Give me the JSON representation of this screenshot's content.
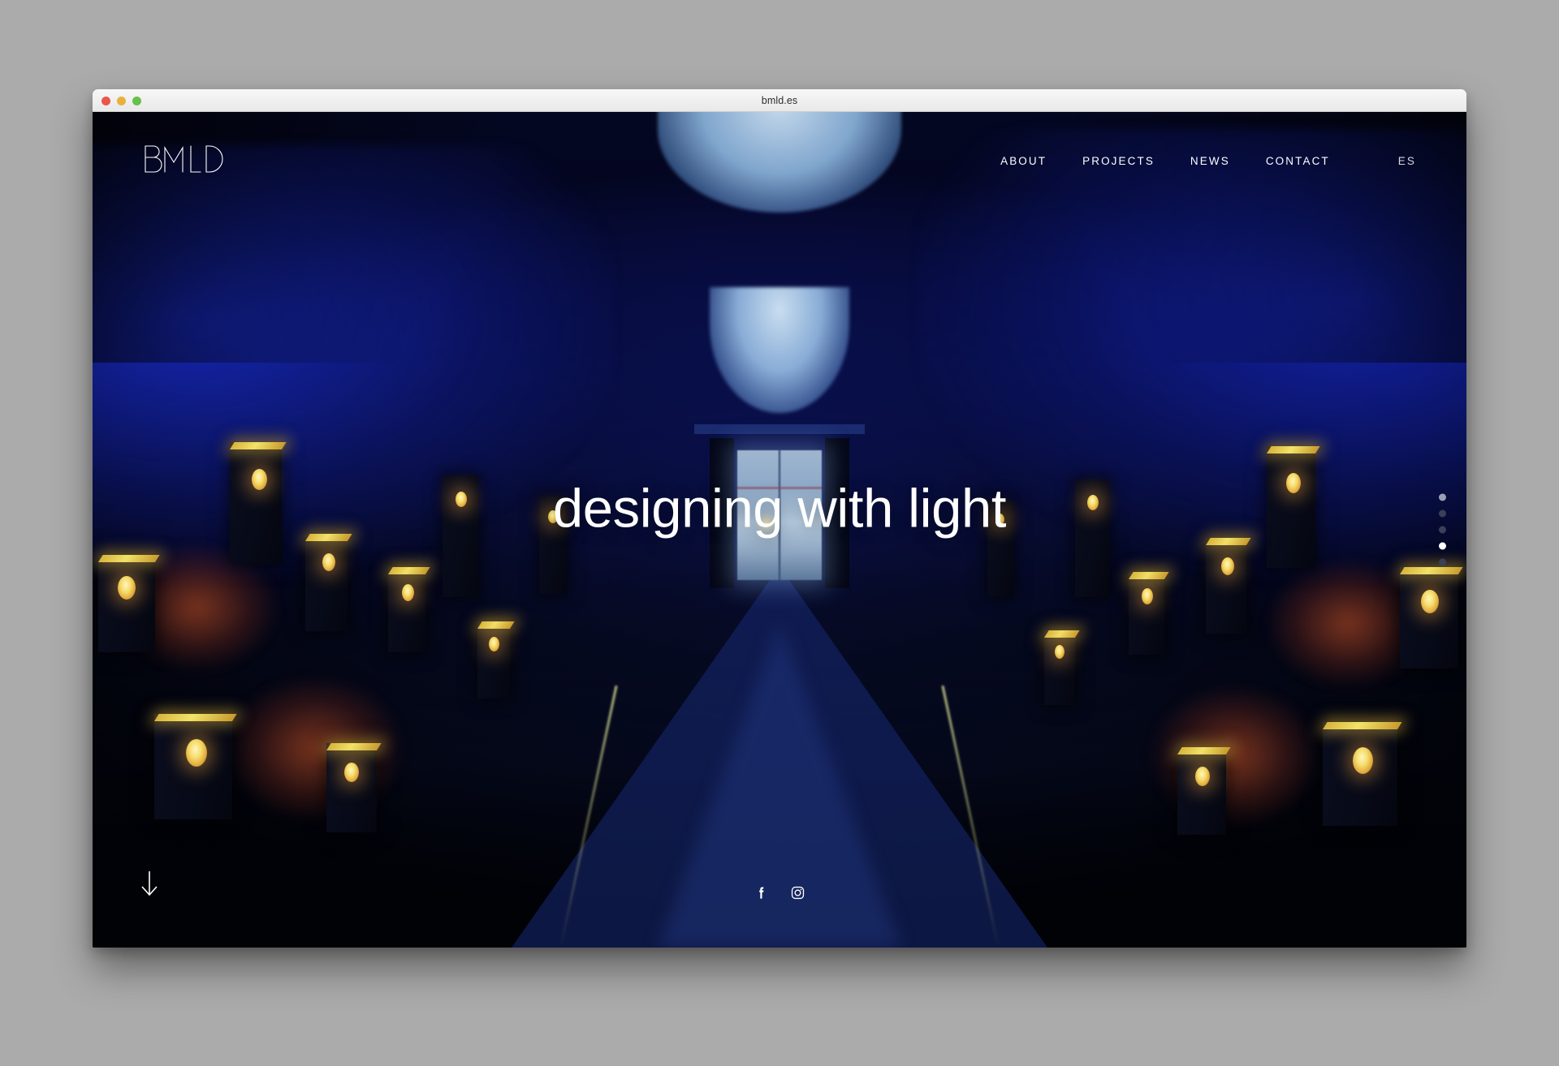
{
  "window": {
    "title": "bmld.es",
    "traffic_lights": [
      {
        "name": "close",
        "color": "#e8564c"
      },
      {
        "name": "minimize",
        "color": "#e9b03c"
      },
      {
        "name": "maximize",
        "color": "#67bf4c"
      }
    ]
  },
  "site": {
    "brand": {
      "name": "BMLD",
      "icon": "bmld-wordmark-logo"
    },
    "nav": [
      {
        "label": "ABOUT"
      },
      {
        "label": "PROJECTS"
      },
      {
        "label": "NEWS"
      },
      {
        "label": "CONTACT"
      }
    ],
    "language": {
      "label": "ES"
    },
    "hero": {
      "headline": "designing with light"
    },
    "scroll_hint": {
      "icon": "arrow-down-icon"
    },
    "social": [
      {
        "name": "facebook",
        "icon": "facebook-icon"
      },
      {
        "name": "instagram",
        "icon": "instagram-icon"
      }
    ],
    "slides": {
      "count": 5,
      "active_index": 3,
      "states": [
        "dim",
        "dark",
        "dark",
        "active",
        "dark"
      ]
    },
    "colors": {
      "page_background": "#ababab",
      "hero_blue": "#121ea0",
      "hero_deep": "#03050f",
      "accent_lamp": "#f5dd6c",
      "text": "#ffffff"
    }
  }
}
